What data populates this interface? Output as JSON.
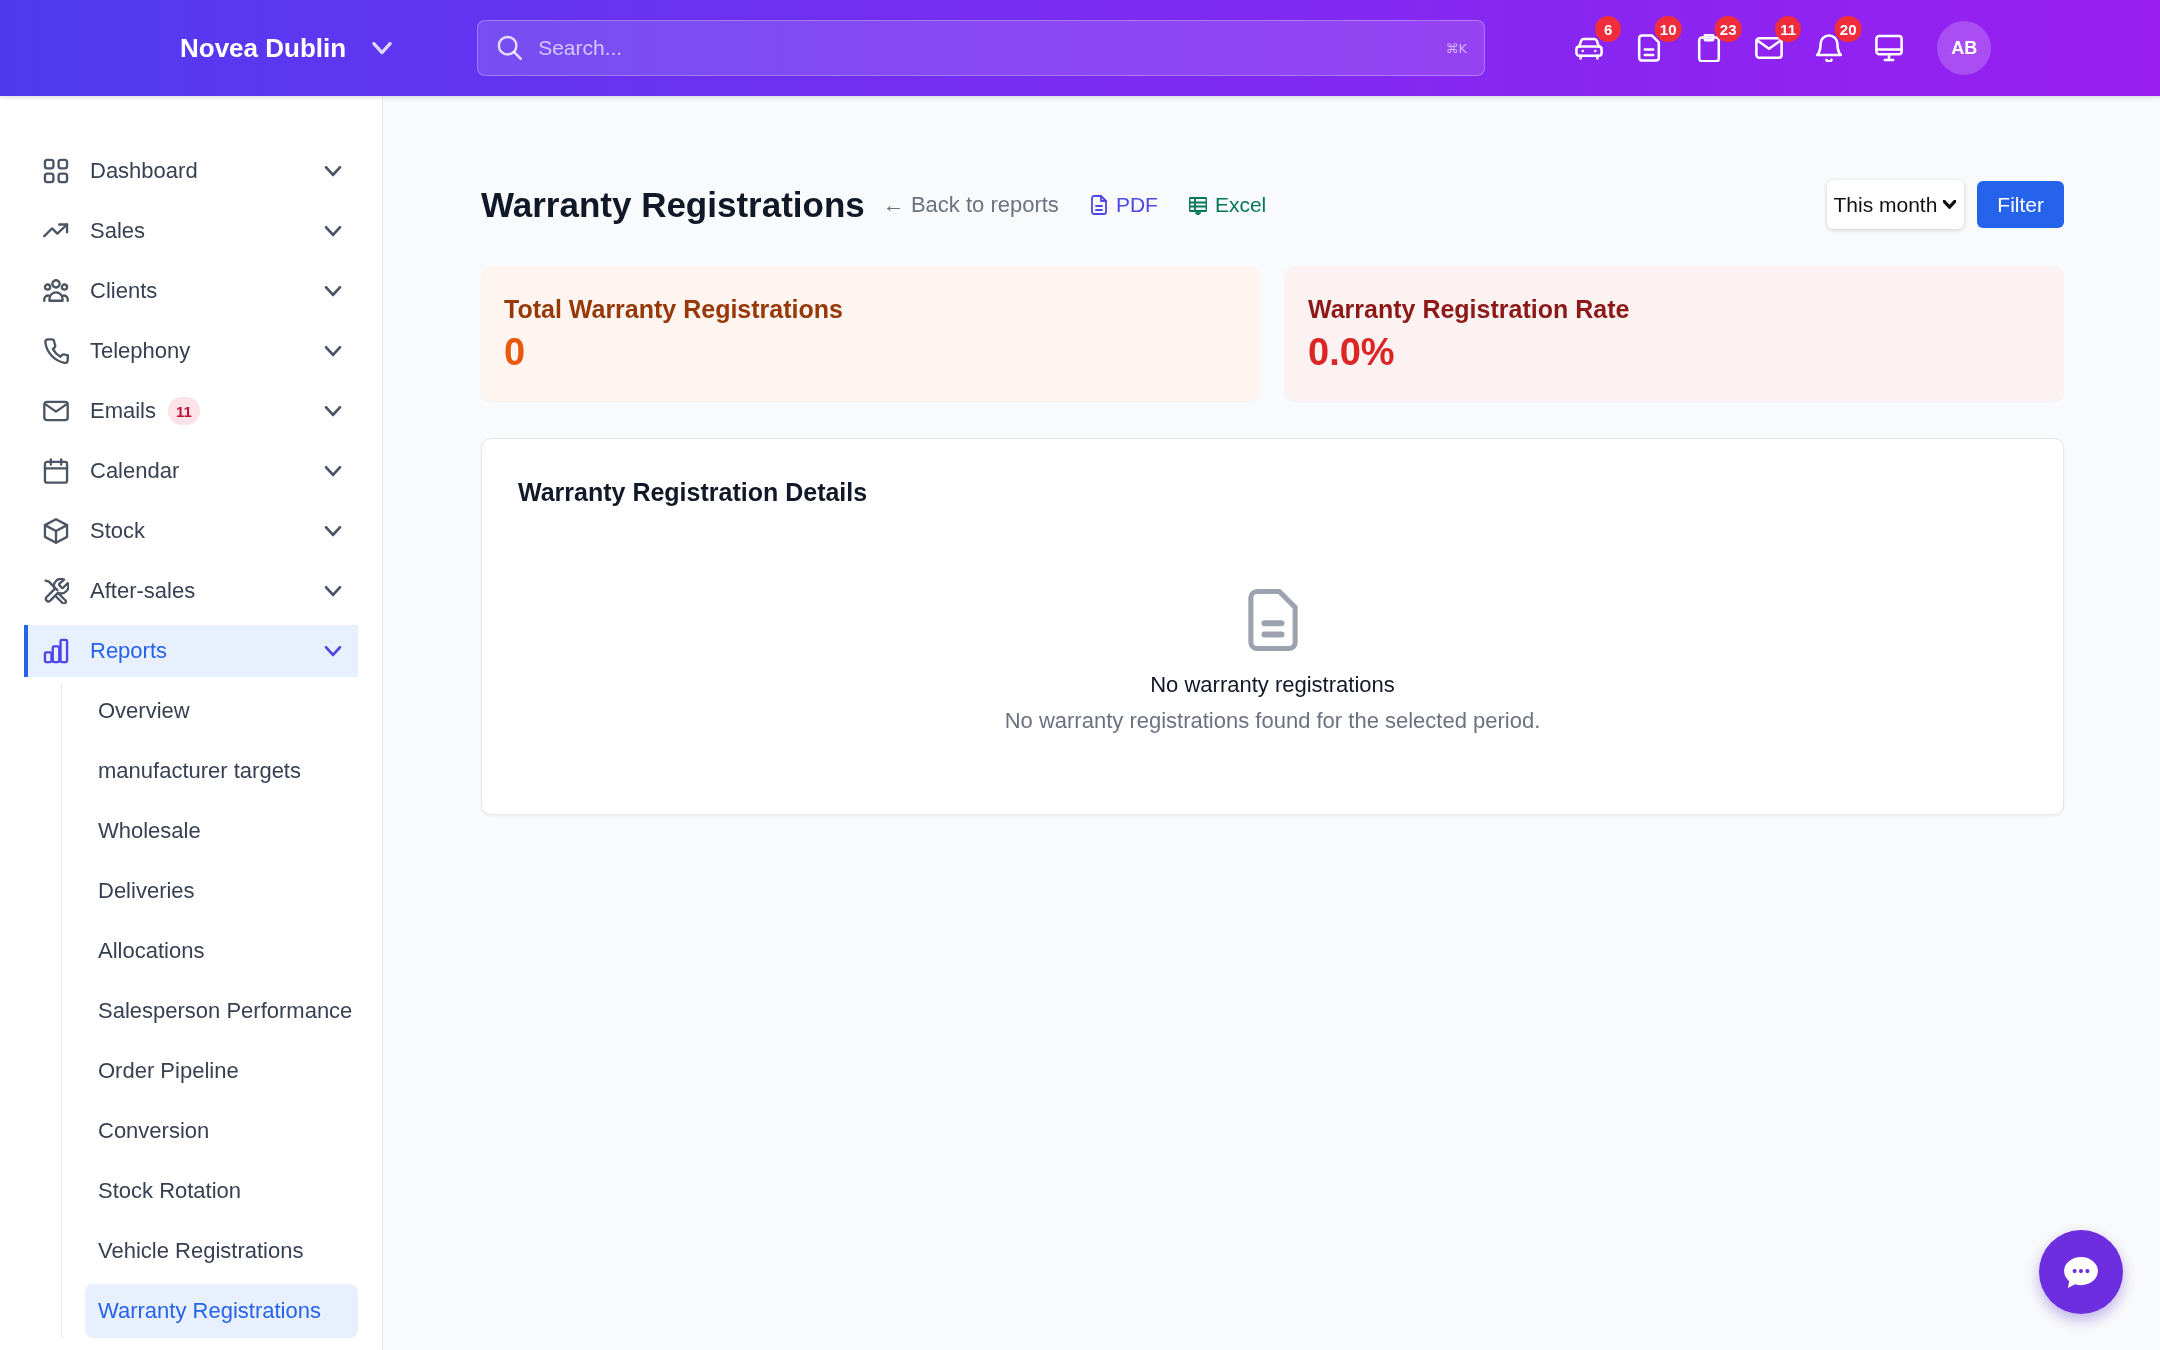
{
  "header": {
    "brand": "Novea Dublin",
    "search": {
      "placeholder": "Search...",
      "shortcut": "⌘K"
    },
    "icon_buttons": [
      {
        "badge": "6"
      },
      {
        "badge": "10"
      },
      {
        "badge": "23"
      },
      {
        "badge": "11"
      },
      {
        "badge": "20"
      }
    ],
    "avatar": "AB"
  },
  "sidebar": {
    "items": [
      {
        "label": "Dashboard",
        "selected": false
      },
      {
        "label": "Sales",
        "selected": false
      },
      {
        "label": "Clients",
        "selected": false
      },
      {
        "label": "Telephony",
        "selected": false
      },
      {
        "label": "Emails",
        "badge": "11",
        "selected": false
      },
      {
        "label": "Calendar",
        "selected": false
      },
      {
        "label": "Stock",
        "selected": false
      },
      {
        "label": "After-sales",
        "selected": false
      },
      {
        "label": "Reports",
        "selected": true,
        "children": [
          {
            "label": "Overview",
            "selected": false
          },
          {
            "label": "manufacturer targets",
            "selected": false
          },
          {
            "label": "Wholesale",
            "selected": false
          },
          {
            "label": "Deliveries",
            "selected": false
          },
          {
            "label": "Allocations",
            "selected": false
          },
          {
            "label": "Salesperson Performance",
            "selected": false
          },
          {
            "label": "Order Pipeline",
            "selected": false
          },
          {
            "label": "Conversion",
            "selected": false
          },
          {
            "label": "Stock Rotation",
            "selected": false
          },
          {
            "label": "Vehicle Registrations",
            "selected": false
          },
          {
            "label": "Warranty Registrations",
            "selected": true
          }
        ]
      }
    ]
  },
  "page": {
    "title": "Warranty Registrations",
    "back_link": "← Back to reports",
    "export_links": [
      {
        "label": "PDF",
        "color": "#4f46e5"
      },
      {
        "label": "Excel",
        "color": "#047857"
      }
    ],
    "period": "This month",
    "filter_button": "Filter"
  },
  "stats": [
    {
      "title": "Total Warranty Registrations",
      "value": "0",
      "color": "#ea580c"
    },
    {
      "title": "Warranty Registration Rate",
      "value": "0.0%",
      "color": "#dc2626"
    }
  ],
  "details": {
    "title": "Warranty Registration Details",
    "empty_title": "No warranty registrations",
    "empty_text": "No warranty registrations found for the selected period."
  }
}
